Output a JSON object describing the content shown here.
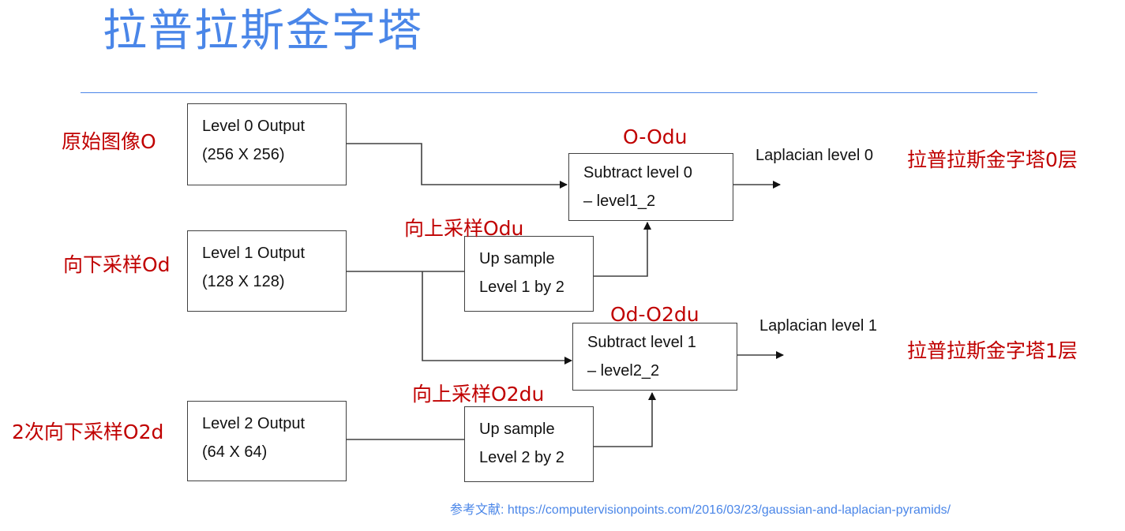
{
  "title": "拉普拉斯金字塔",
  "boxes": {
    "level0": {
      "line1": "Level 0 Output",
      "line2": "(256 X 256)"
    },
    "level1": {
      "line1": "Level 1 Output",
      "line2": "(128 X 128)"
    },
    "level2": {
      "line1": "Level 2 Output",
      "line2": "(64 X 64)"
    },
    "upsample1": {
      "line1": "Up sample",
      "line2": "Level 1 by 2"
    },
    "upsample2": {
      "line1": "Up sample",
      "line2": "Level 2 by 2"
    },
    "subtract0": {
      "line1": "Subtract level 0",
      "line2": "– level1_2"
    },
    "subtract1": {
      "line1": "Subtract level 1",
      "line2": "– level2_2"
    }
  },
  "annotations": {
    "original_image": "原始图像O",
    "downsample": "向下采样Od",
    "downsample_twice": "2次向下采样O2d",
    "upsample_odu": "向上采样Odu",
    "upsample_o2du": "向上采样O2du",
    "diff0": "O-Odu",
    "diff1": "Od-O2du",
    "pyramid_level0": "拉普拉斯金字塔0层",
    "pyramid_level1": "拉普拉斯金字塔1层"
  },
  "outputs": {
    "laplacian0": "Laplacian level 0",
    "laplacian1": "Laplacian level 1"
  },
  "reference": {
    "label": "参考文献:",
    "url": "https://computervisionpoints.com/2016/03/23/gaussian-and-laplacian-pyramids/"
  },
  "colors": {
    "title": "#4a86e8",
    "annotation": "#c00000",
    "line": "#404040"
  }
}
